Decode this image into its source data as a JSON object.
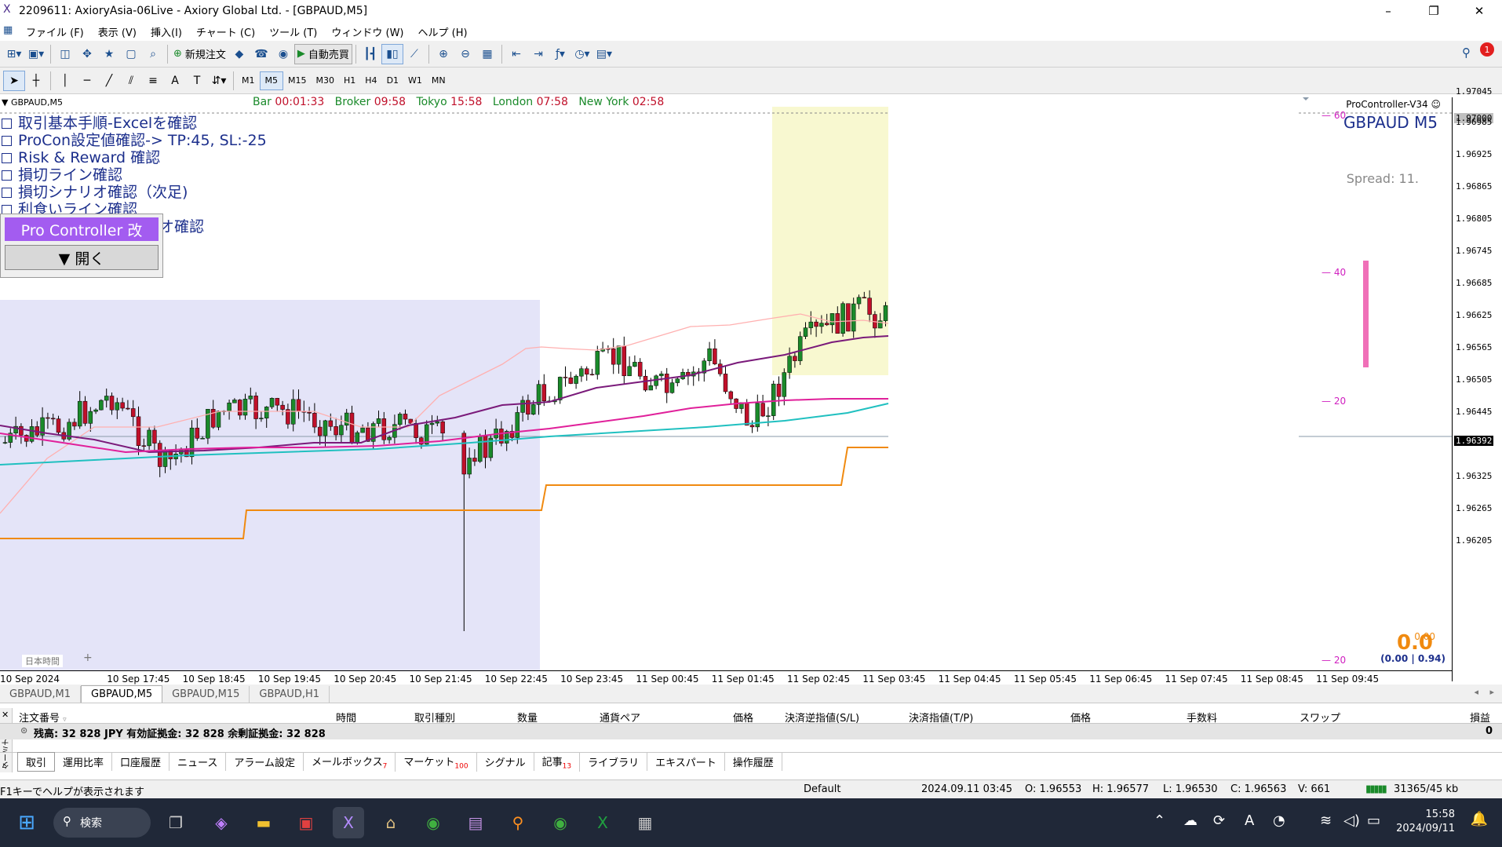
{
  "window": {
    "title": "2209611: AxioryAsia-06Live - Axiory Global Ltd. - [GBPAUD,M5]",
    "controls": [
      "–",
      "❐",
      "✕"
    ]
  },
  "menu": [
    "ファイル (F)",
    "表示 (V)",
    "挿入(I)",
    "チャート (C)",
    "ツール (T)",
    "ウィンドウ (W)",
    "ヘルプ (H)"
  ],
  "toolbar": {
    "new_order": "新規注文",
    "auto_trade": "自動売買",
    "timeframes": [
      "M1",
      "M5",
      "M15",
      "M30",
      "H1",
      "H4",
      "D1",
      "W1",
      "MN"
    ],
    "active_timeframe": "M5",
    "notification_count": "1"
  },
  "chart": {
    "symbol_header": "GBPAUD,M5",
    "timers": {
      "bar_label": "Bar",
      "bar_value": "00:01:33",
      "broker_label": "Broker",
      "broker_value": "09:58",
      "tokyo_label": "Tokyo",
      "tokyo_value": "15:58",
      "london_label": "London",
      "london_value": "07:58",
      "newyork_label": "New York",
      "newyork_value": "02:58"
    },
    "indicator_name": "ProController-V34",
    "symbol_big": "GBPAUD M5",
    "spread": "Spread: 11.",
    "pnl_big": "0.0",
    "pnl_small": "0.00",
    "pnl_detail": "(0.00 | 0.94)",
    "checklist": [
      "取引基本手順-Excelを確認",
      "ProCon設定値確認-> TP:45, SL:-25",
      "Risk & Reward 確認",
      "損切ライン確認",
      "損切シナリオ確認（次足)",
      "利食いライン確認",
      "リオ確認"
    ],
    "panel": {
      "title": "Pro Controller 改",
      "open_button": "▼ 開く"
    },
    "session_label": "日本時間",
    "pip_marks": [
      "60",
      "40",
      "20",
      "20"
    ],
    "y_axis": [
      "1.97045",
      "1.97000",
      "1.96985",
      "1.96925",
      "1.96865",
      "1.96805",
      "1.96745",
      "1.96685",
      "1.96625",
      "1.96565",
      "1.96505",
      "1.96445",
      "1.96392",
      "1.96325",
      "1.96265",
      "1.96205"
    ],
    "current_price": "1.96392",
    "level_price": "1.97000",
    "x_axis": [
      "10 Sep 2024",
      "10 Sep 17:45",
      "10 Sep 18:45",
      "10 Sep 19:45",
      "10 Sep 20:45",
      "10 Sep 21:45",
      "10 Sep 22:45",
      "10 Sep 23:45",
      "11 Sep 00:45",
      "11 Sep 01:45",
      "11 Sep 02:45",
      "11 Sep 03:45",
      "11 Sep 04:45",
      "11 Sep 05:45",
      "11 Sep 06:45",
      "11 Sep 07:45",
      "11 Sep 08:45",
      "11 Sep 09:45"
    ]
  },
  "chart_tabs": [
    "GBPAUD,M1",
    "GBPAUD,M5",
    "GBPAUD,M15",
    "GBPAUD,H1"
  ],
  "active_chart_tab": "GBPAUD,M5",
  "terminal": {
    "columns": [
      "注文番号",
      "時間",
      "取引種別",
      "数量",
      "通貨ペア",
      "価格",
      "決済逆指値(S/L)",
      "決済指値(T/P)",
      "価格",
      "手数料",
      "スワップ",
      "損益"
    ],
    "balance": "残高: 32 828 JPY  有効証拠金: 32 828  余剰証拠金: 32 828",
    "profit": "0",
    "tabs": [
      {
        "label": "取引",
        "badge": ""
      },
      {
        "label": "運用比率",
        "badge": ""
      },
      {
        "label": "口座履歴",
        "badge": ""
      },
      {
        "label": "ニュース",
        "badge": ""
      },
      {
        "label": "アラーム設定",
        "badge": ""
      },
      {
        "label": "メールボックス",
        "badge": "7"
      },
      {
        "label": "マーケット",
        "badge": "100"
      },
      {
        "label": "シグナル",
        "badge": ""
      },
      {
        "label": "記事",
        "badge": "13"
      },
      {
        "label": "ライブラリ",
        "badge": ""
      },
      {
        "label": "エキスパート",
        "badge": ""
      },
      {
        "label": "操作履歴",
        "badge": ""
      }
    ],
    "side_label": "ターミナル"
  },
  "status": {
    "help": "F1キーでヘルプが表示されます",
    "profile": "Default",
    "datetime": "2024.09.11 03:45",
    "open": "O: 1.96553",
    "high": "H: 1.96577",
    "low": "L: 1.96530",
    "close": "C: 1.96563",
    "volume": "V: 661",
    "traffic": "31365/45 kb"
  },
  "taskbar": {
    "search": "検索",
    "time": "15:58",
    "date": "2024/09/11"
  },
  "colors": {
    "bull": "#1a8a2a",
    "bear": "#c0102a",
    "ma_fast": "#ffb0b0",
    "ma_mid": "#7a1a7a",
    "ma_slow": "#e0209a",
    "ma_long": "#20c0c0",
    "stop_line": "#f08a10",
    "session_tokyo": "#e4e4f8",
    "session_current": "#f8f8d0"
  }
}
